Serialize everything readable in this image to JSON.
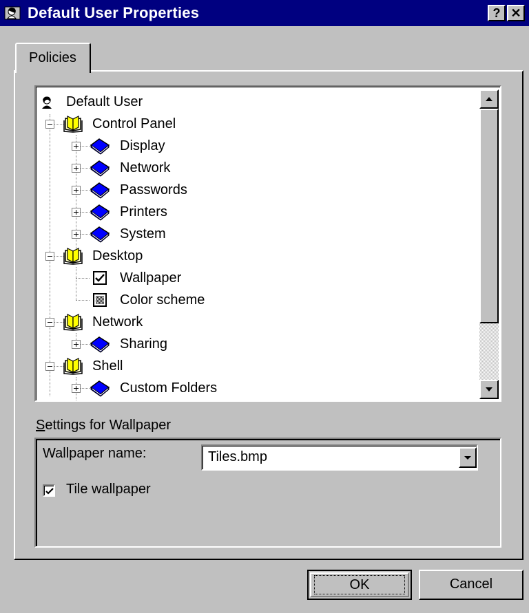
{
  "window": {
    "title": "Default User Properties",
    "help_label": "?",
    "close_label": "✕"
  },
  "tabs": [
    {
      "label": "Policies",
      "active": true
    }
  ],
  "tree": {
    "root": "Default User",
    "items": [
      {
        "label": "Control Panel",
        "kind": "category-open",
        "level": 1,
        "expander": "minus"
      },
      {
        "label": "Display",
        "kind": "policy-book",
        "level": 2,
        "expander": "plus"
      },
      {
        "label": "Network",
        "kind": "policy-book",
        "level": 2,
        "expander": "plus"
      },
      {
        "label": "Passwords",
        "kind": "policy-book",
        "level": 2,
        "expander": "plus"
      },
      {
        "label": "Printers",
        "kind": "policy-book",
        "level": 2,
        "expander": "plus"
      },
      {
        "label": "System",
        "kind": "policy-book",
        "level": 2,
        "expander": "plus"
      },
      {
        "label": "Desktop",
        "kind": "category-open",
        "level": 1,
        "expander": "minus"
      },
      {
        "label": "Wallpaper",
        "kind": "checkbox-checked",
        "level": 2,
        "expander": "none"
      },
      {
        "label": "Color scheme",
        "kind": "checkbox-grayed",
        "level": 2,
        "expander": "none"
      },
      {
        "label": "Network",
        "kind": "category-open",
        "level": 1,
        "expander": "minus"
      },
      {
        "label": "Sharing",
        "kind": "policy-book",
        "level": 2,
        "expander": "plus"
      },
      {
        "label": "Shell",
        "kind": "category-open",
        "level": 1,
        "expander": "minus"
      },
      {
        "label": "Custom Folders",
        "kind": "policy-book",
        "level": 2,
        "expander": "plus"
      }
    ]
  },
  "settings": {
    "label_prefix": "S",
    "label_rest": "ettings for Wallpaper",
    "wallpaper_name_label": "Wallpaper name:",
    "wallpaper_name_value": "Tiles.bmp",
    "tile_label": "Tile wallpaper",
    "tile_checked": true
  },
  "buttons": {
    "ok": "OK",
    "cancel": "Cancel"
  },
  "colors": {
    "titlebar": "#000080",
    "face": "#c0c0c0",
    "book_blue": "#0000ff"
  }
}
